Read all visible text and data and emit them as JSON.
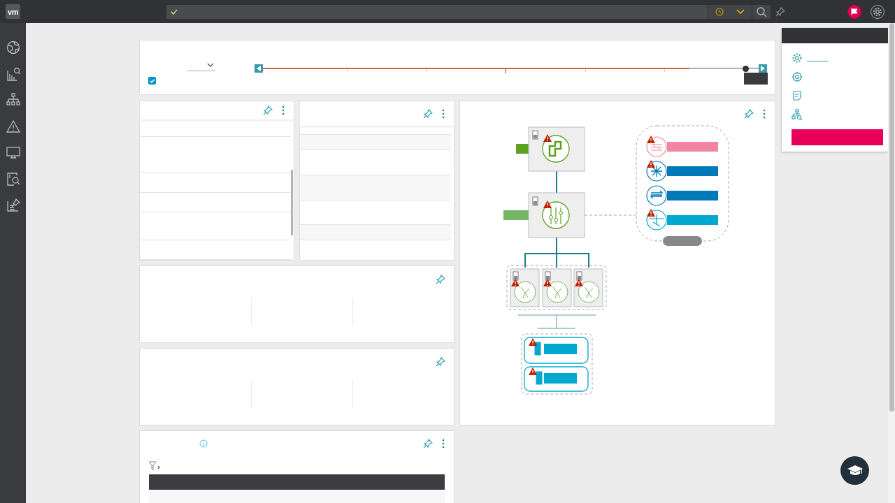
{
  "topbar": {
    "logo": "vm",
    "search": {
      "valid": true
    }
  },
  "sidebar": {
    "items": [
      {
        "kind": "globe"
      },
      {
        "kind": "chart-search"
      },
      {
        "kind": "hierarchy"
      },
      {
        "kind": "warning"
      },
      {
        "kind": "monitor"
      },
      {
        "kind": "doc-search"
      },
      {
        "kind": "chart-pin"
      }
    ]
  },
  "time_filter": {
    "checked": true,
    "timeline": {
      "fill": {
        "level": 0.86
      },
      "handle": {
        "level": 0.975
      }
    }
  },
  "topology": {
    "services": [
      {
        "kind": "firewall",
        "color": "#f285a0",
        "alert": true
      },
      {
        "kind": "router",
        "color": "#0079b8",
        "alert": true
      },
      {
        "kind": "switch",
        "color": "#0079b8",
        "alert": false
      },
      {
        "kind": "balancer",
        "color": "#00a7cf",
        "alert": true
      }
    ]
  },
  "settings_menu": {
    "items": [
      {
        "kind": "gear"
      },
      {
        "kind": "target"
      },
      {
        "kind": "note"
      },
      {
        "kind": "hierarchy-search"
      }
    ]
  }
}
